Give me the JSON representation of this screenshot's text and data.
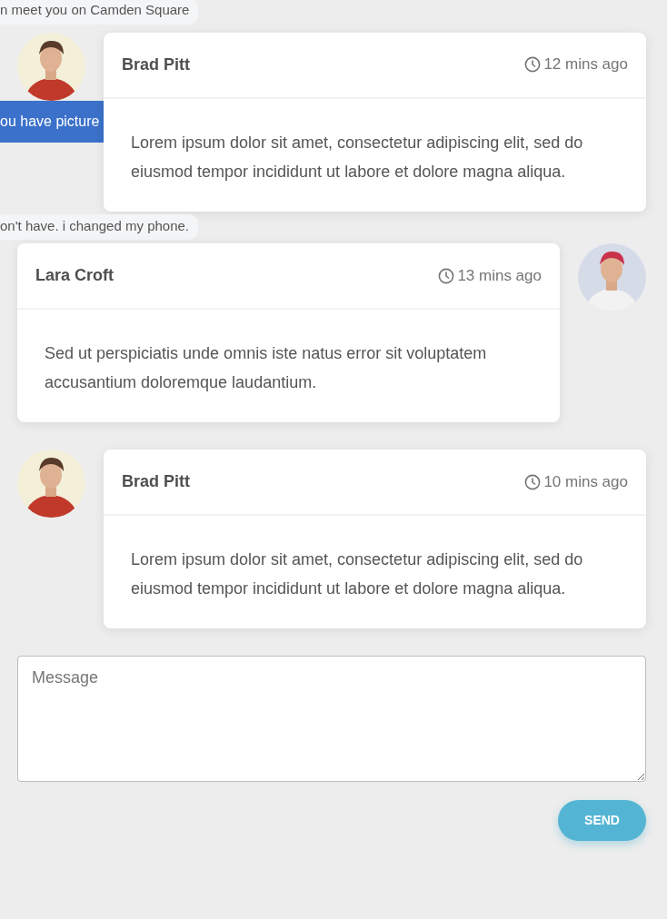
{
  "thread": [
    {
      "kind": "bubble",
      "text": "n meet you on Camden Square"
    },
    {
      "kind": "card",
      "author": "Brad Pitt",
      "time": "12 mins ago",
      "text": "Lorem ipsum dolor sit amet, consectetur adipiscing elit, sed do eiusmod tempor incididunt ut labore et dolore magna aliqua.",
      "note": "ou have picture"
    },
    {
      "kind": "bubble",
      "text": "on't have. i changed my phone."
    },
    {
      "kind": "reply",
      "author": "Lara Croft",
      "time": "13 mins ago",
      "text": "Sed ut perspiciatis unde omnis iste natus error sit voluptatem accusantium doloremque laudantium."
    },
    {
      "kind": "card",
      "author": "Brad Pitt",
      "time": "10 mins ago",
      "text": "Lorem ipsum dolor sit amet, consectetur adipiscing elit, sed do eiusmod tempor incididunt ut labore et dolore magna aliqua."
    }
  ],
  "composer": {
    "placeholder": "Message",
    "button": "SEND"
  }
}
